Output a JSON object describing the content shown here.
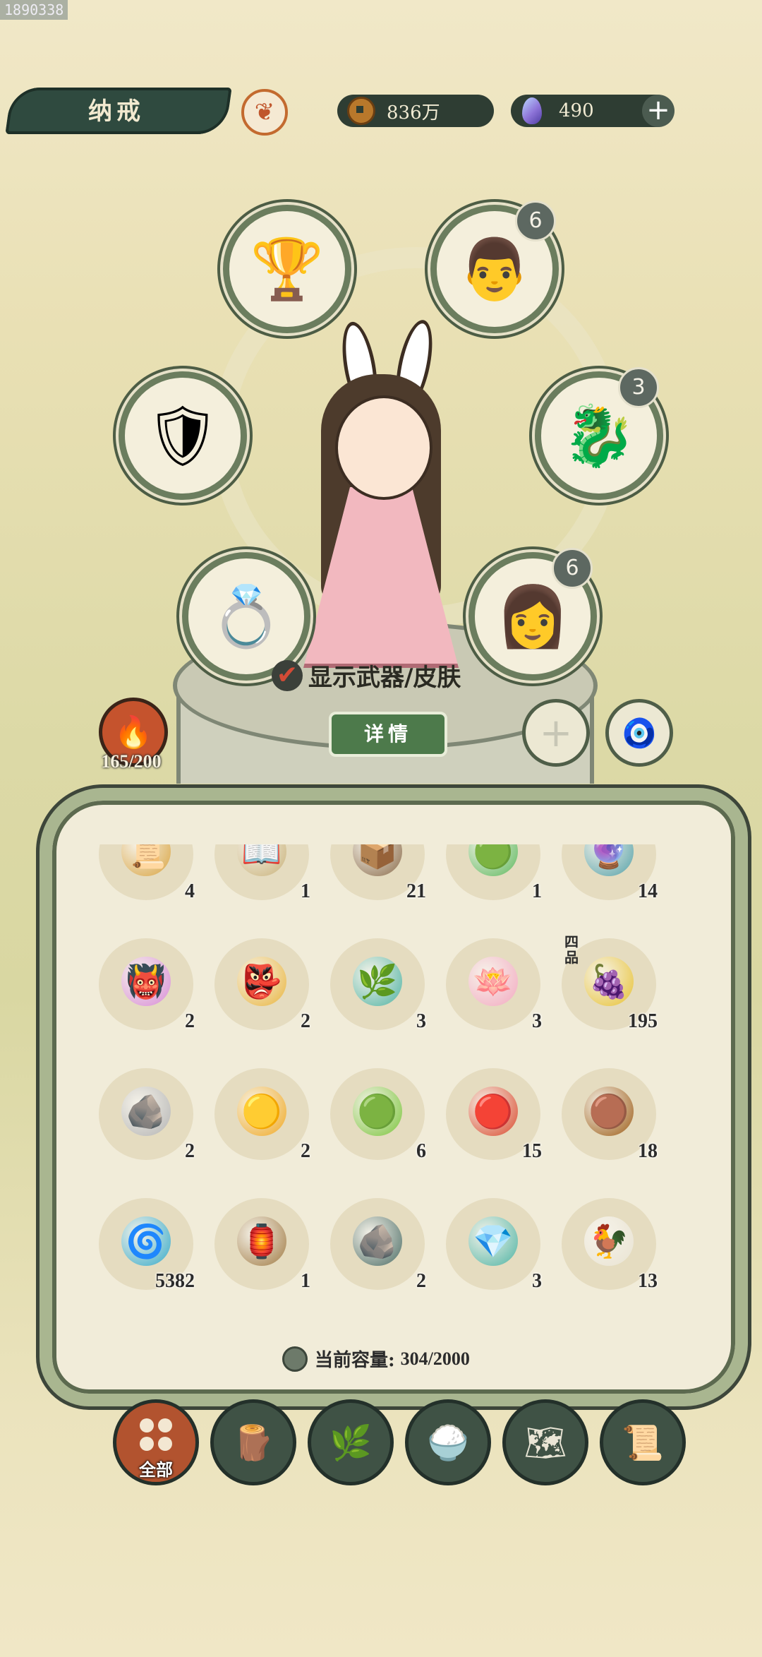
{
  "watermark": "1890338",
  "header": {
    "title": "纳戒",
    "emblem_icon": "phoenix-emblem-icon",
    "currency": {
      "coins": "836万",
      "coin_icon": "copper-coin-icon",
      "gems": "490",
      "gem_icon": "spirit-gem-icon",
      "add_label": "+"
    }
  },
  "equipment": {
    "slots": [
      {
        "name": "lotus-goblet",
        "icon": "🏆",
        "badge": ""
      },
      {
        "name": "official-portrait",
        "icon": "👨",
        "badge": "6"
      },
      {
        "name": "golden-armor",
        "icon": "🛡",
        "badge": ""
      },
      {
        "name": "water-beast",
        "icon": "🐉",
        "badge": "3"
      },
      {
        "name": "jade-ring",
        "icon": "💍",
        "badge": ""
      },
      {
        "name": "lady-portrait",
        "icon": "👩",
        "badge": "6"
      }
    ]
  },
  "character": {
    "show_label": "显示武器/皮肤",
    "checked": true,
    "detail_label": "详情"
  },
  "pet": {
    "icon": "🔥",
    "count": "165/200"
  },
  "side_buttons": {
    "add": "+",
    "pendant_icon": "jade-pendant-icon"
  },
  "inventory": {
    "items": [
      {
        "icon": "📜",
        "qty": "4",
        "grade": "",
        "color": "#d9a441"
      },
      {
        "icon": "📖",
        "qty": "1",
        "grade": "",
        "color": "#c9b27a"
      },
      {
        "icon": "📦",
        "qty": "21",
        "grade": "",
        "color": "#8a6b4a"
      },
      {
        "icon": "🟢",
        "qty": "1",
        "grade": "",
        "color": "#5cb85c"
      },
      {
        "icon": "🔮",
        "qty": "14",
        "grade": "",
        "color": "#53a0a8"
      },
      {
        "icon": "👹",
        "qty": "2",
        "grade": "",
        "color": "#d88ad8"
      },
      {
        "icon": "👺",
        "qty": "2",
        "grade": "",
        "color": "#e9b43c"
      },
      {
        "icon": "🌿",
        "qty": "3",
        "grade": "",
        "color": "#4fb3a3"
      },
      {
        "icon": "🪷",
        "qty": "3",
        "grade": "",
        "color": "#f3a8c0"
      },
      {
        "icon": "🍇",
        "qty": "195",
        "grade": "四品",
        "color": "#e7c131"
      },
      {
        "icon": "🪨",
        "qty": "2",
        "grade": "",
        "color": "#b4b4b4"
      },
      {
        "icon": "🟡",
        "qty": "2",
        "grade": "",
        "color": "#f0a821"
      },
      {
        "icon": "🟢",
        "qty": "6",
        "grade": "",
        "color": "#79c43a"
      },
      {
        "icon": "🔴",
        "qty": "15",
        "grade": "",
        "color": "#d9472b"
      },
      {
        "icon": "🟤",
        "qty": "18",
        "grade": "",
        "color": "#9b5a14"
      },
      {
        "icon": "🌀",
        "qty": "5382",
        "grade": "",
        "color": "#34a9c9"
      },
      {
        "icon": "🏮",
        "qty": "1",
        "grade": "",
        "color": "#a07a43"
      },
      {
        "icon": "🪨",
        "qty": "2",
        "grade": "",
        "color": "#4a6b64"
      },
      {
        "icon": "💎",
        "qty": "3",
        "grade": "",
        "color": "#4db3a3"
      },
      {
        "icon": "🐓",
        "qty": "13",
        "grade": "",
        "color": "#e9e3d2"
      }
    ],
    "capacity_label": "当前容量:",
    "capacity_value": "304/2000"
  },
  "tabs": [
    {
      "label": "全部",
      "icon": "all-grid-icon",
      "active": true
    },
    {
      "label": "",
      "icon": "log-wood-icon",
      "active": false
    },
    {
      "label": "",
      "icon": "herb-sprig-icon",
      "active": false
    },
    {
      "label": "",
      "icon": "rice-bowl-icon",
      "active": false
    },
    {
      "label": "",
      "icon": "map-fragment-icon",
      "active": false
    },
    {
      "label": "",
      "icon": "scroll-icon",
      "active": false
    }
  ]
}
